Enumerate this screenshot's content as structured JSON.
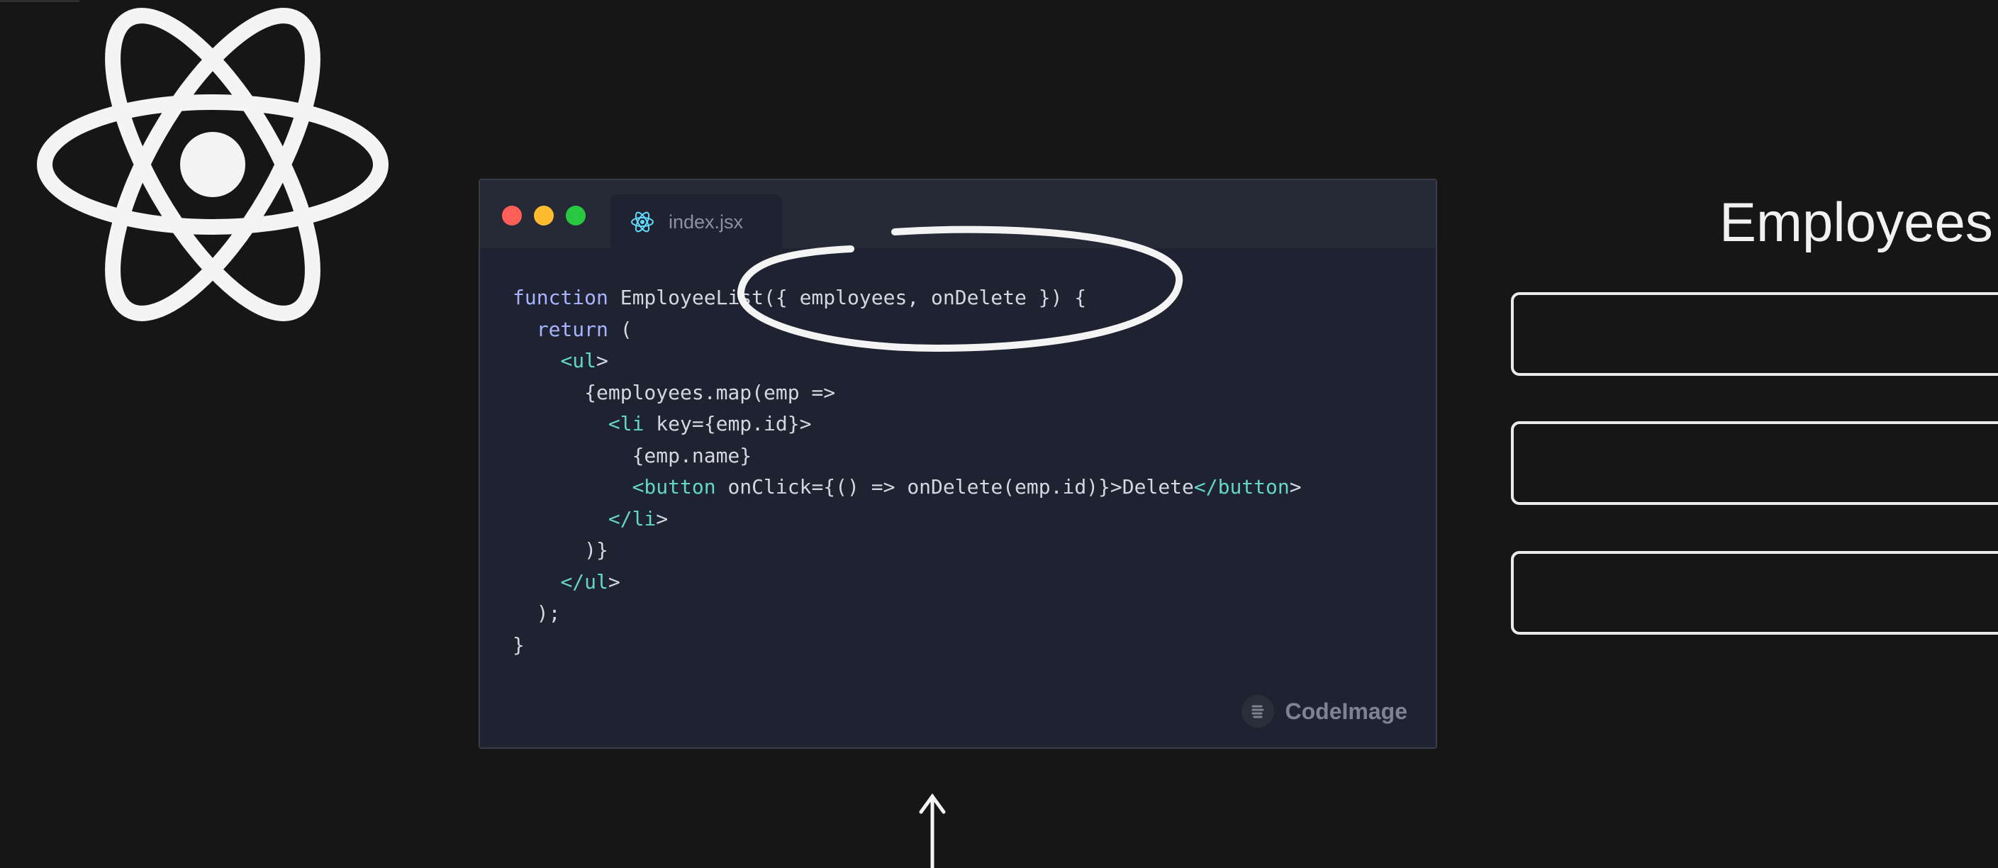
{
  "editor": {
    "tab_filename": "index.jsx",
    "tab_icon": "react-icon",
    "window_controls": [
      "close",
      "minimize",
      "maximize"
    ],
    "watermark": "CodeImage",
    "watermark_icon": "codeimage-icon",
    "language": "jsx",
    "code_lines": [
      "function EmployeeList({ employees, onDelete }) {",
      "  return (",
      "    <ul>",
      "      {employees.map(emp =>",
      "        <li key={emp.id}>",
      "          {emp.name}",
      "          <button onClick={() => onDelete(emp.id)}>Delete</button>",
      "        </li>",
      "      )}",
      "    </ul>",
      "  );",
      "}"
    ]
  },
  "logo": {
    "icon": "react-logo-icon"
  },
  "employee_panel": {
    "title": "Employees",
    "row_count": 3
  },
  "annotations": {
    "highlight_circle": "hand-drawn ellipse around props",
    "arrow_icon": "up-arrow-icon"
  },
  "colors": {
    "background": "#161616",
    "editor_bg": "#1f2230",
    "keyword": "#a8b4ff",
    "tag": "#62d8c4",
    "text": "#d4d7e0",
    "window_red": "#ff5f57",
    "window_yellow": "#febc2e",
    "window_green": "#28c840"
  }
}
